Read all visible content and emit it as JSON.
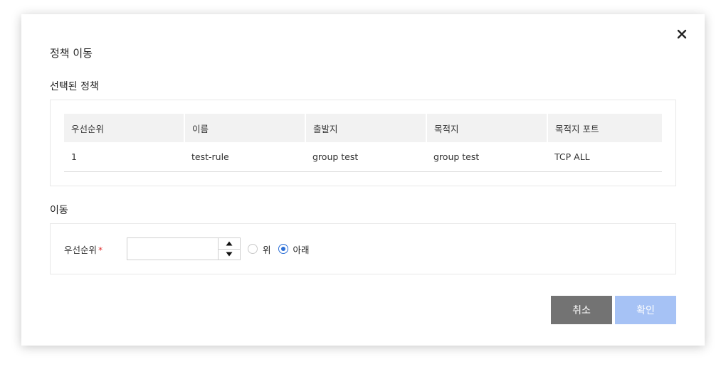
{
  "dialog": {
    "title": "정책 이동",
    "close_icon": "close-icon"
  },
  "selected_policy": {
    "section_title": "선택된 정책",
    "columns": [
      "우선순위",
      "이름",
      "출발지",
      "목적지",
      "목적지 포트"
    ],
    "rows": [
      [
        "1",
        "test-rule",
        "group test",
        "group test",
        "TCP ALL"
      ]
    ]
  },
  "move": {
    "section_title": "이동",
    "priority_label": "우선순위",
    "required_mark": "*",
    "priority_value": "",
    "stepper_up_icon": "caret-up-icon",
    "stepper_down_icon": "caret-down-icon",
    "radio_options": [
      {
        "label": "위",
        "checked": false
      },
      {
        "label": "아래",
        "checked": true
      }
    ]
  },
  "buttons": {
    "cancel_label": "취소",
    "confirm_label": "확인"
  },
  "colors": {
    "cancel_button": "#737373",
    "confirm_button": "#a6c2f5",
    "radio_accent": "#2c6fd6",
    "required_mark": "#e03131"
  }
}
